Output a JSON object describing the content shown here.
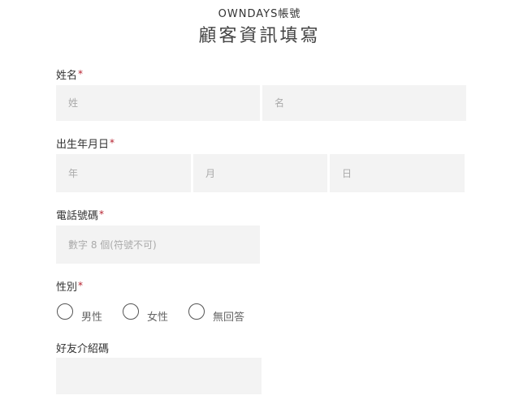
{
  "header": {
    "brand": "OWNDAYS帳號",
    "title": "顧客資訊填寫"
  },
  "form": {
    "required_mark": "*",
    "name": {
      "label": "姓名",
      "last_name_placeholder": "姓",
      "first_name_placeholder": "名"
    },
    "birthday": {
      "label": "出生年月日",
      "year_placeholder": "年",
      "month_placeholder": "月",
      "day_placeholder": "日"
    },
    "phone": {
      "label": "電話號碼",
      "placeholder": "數字 8 個(符號不可)"
    },
    "gender": {
      "label": "性別",
      "options": [
        {
          "label": "男性",
          "selected": false
        },
        {
          "label": "女性",
          "selected": false
        },
        {
          "label": "無回答",
          "selected": false
        }
      ]
    },
    "referral": {
      "label": "好友介紹碼",
      "placeholder": ""
    }
  },
  "colors": {
    "required": "#b5202e",
    "field_background": "#f3f3f3",
    "placeholder": "#aaaaaa",
    "text": "#333333"
  }
}
